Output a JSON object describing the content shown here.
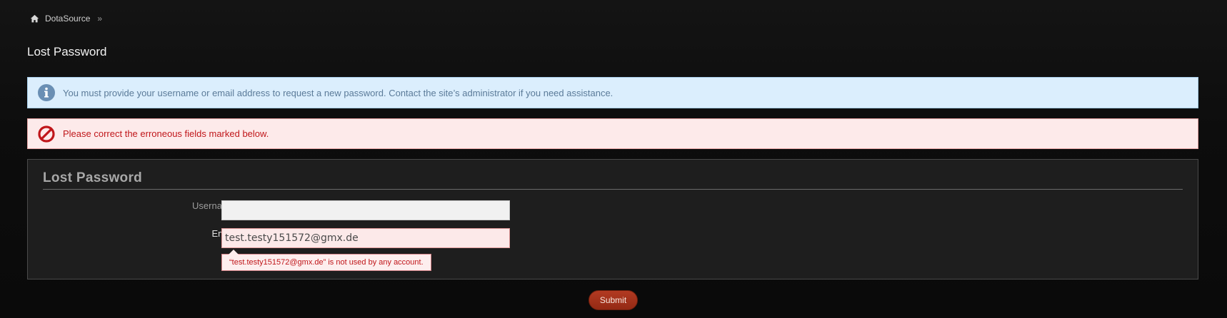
{
  "breadcrumb": {
    "home_icon": "home-icon",
    "home_label": "DotaSource",
    "separator": "»"
  },
  "page_title": "Lost Password",
  "info_notice": {
    "icon": "info-icon",
    "text": "You must provide your username or email address to request a new password. Contact the site’s administrator if you need assistance.",
    "color": "#dbeefd"
  },
  "error_notice": {
    "icon": "prohibited-icon",
    "text": "Please correct the erroneous fields marked below.",
    "color": "#fdeaea"
  },
  "form": {
    "legend": "Lost Password",
    "username": {
      "label": "Username",
      "value": ""
    },
    "email": {
      "label": "Email",
      "value": "test.testy151572@gmx.de",
      "error": "“test.testy151572@gmx.de” is not used by any account."
    },
    "submit_label": "Submit",
    "submit_color": "#b23a22"
  }
}
